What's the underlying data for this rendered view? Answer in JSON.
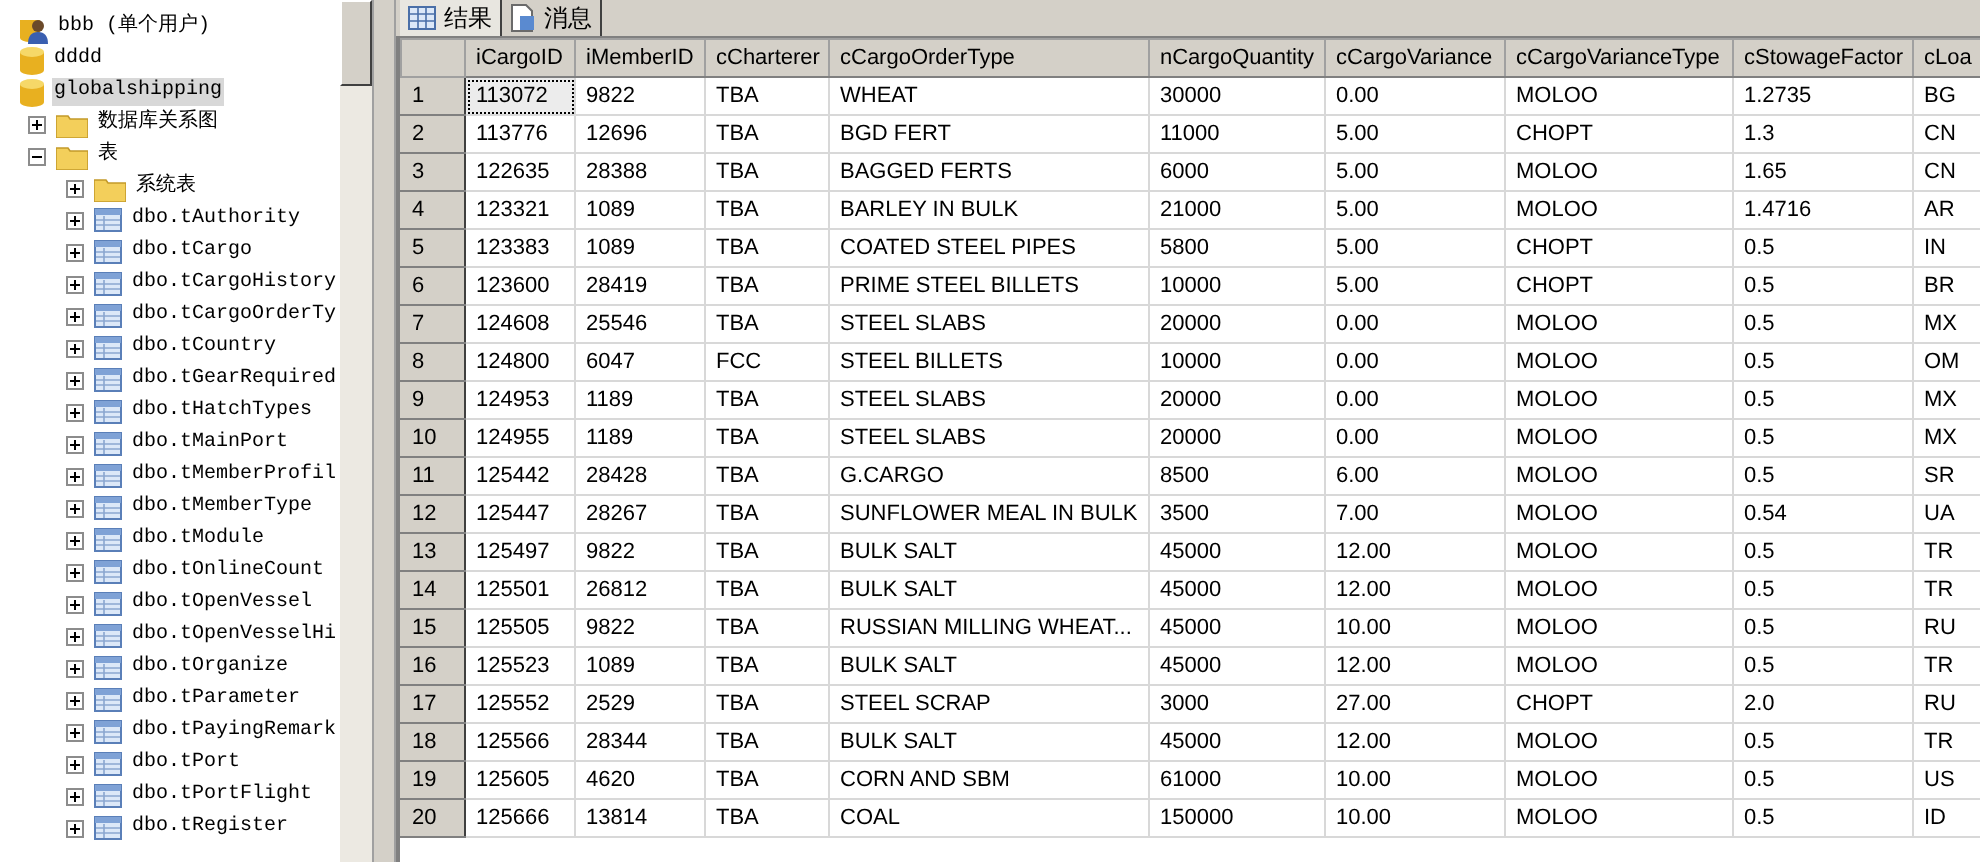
{
  "tree": [
    {
      "label": "bbb (单个用户)",
      "kind": "user"
    },
    {
      "label": "dddd",
      "kind": "database"
    },
    {
      "label": "globalshipping",
      "kind": "database",
      "selected": true,
      "children": [
        {
          "label": "数据库关系图",
          "kind": "folder",
          "expanded": false
        },
        {
          "label": "表",
          "kind": "folder",
          "expanded": true,
          "children": [
            {
              "label": "系统表",
              "kind": "folder",
              "expanded": false
            },
            {
              "label": "dbo.tAuthority",
              "kind": "table",
              "expanded": false
            },
            {
              "label": "dbo.tCargo",
              "kind": "table",
              "expanded": false
            },
            {
              "label": "dbo.tCargoHistory",
              "kind": "table",
              "expanded": false
            },
            {
              "label": "dbo.tCargoOrderTy",
              "kind": "table",
              "expanded": false
            },
            {
              "label": "dbo.tCountry",
              "kind": "table",
              "expanded": false
            },
            {
              "label": "dbo.tGearRequired",
              "kind": "table",
              "expanded": false
            },
            {
              "label": "dbo.tHatchTypes",
              "kind": "table",
              "expanded": false
            },
            {
              "label": "dbo.tMainPort",
              "kind": "table",
              "expanded": false
            },
            {
              "label": "dbo.tMemberProfil",
              "kind": "table",
              "expanded": false
            },
            {
              "label": "dbo.tMemberType",
              "kind": "table",
              "expanded": false
            },
            {
              "label": "dbo.tModule",
              "kind": "table",
              "expanded": false
            },
            {
              "label": "dbo.tOnlineCount",
              "kind": "table",
              "expanded": false
            },
            {
              "label": "dbo.tOpenVessel",
              "kind": "table",
              "expanded": false
            },
            {
              "label": "dbo.tOpenVesselHi",
              "kind": "table",
              "expanded": false
            },
            {
              "label": "dbo.tOrganize",
              "kind": "table",
              "expanded": false
            },
            {
              "label": "dbo.tParameter",
              "kind": "table",
              "expanded": false
            },
            {
              "label": "dbo.tPayingRemark",
              "kind": "table",
              "expanded": false
            },
            {
              "label": "dbo.tPort",
              "kind": "table",
              "expanded": false
            },
            {
              "label": "dbo.tPortFlight",
              "kind": "table",
              "expanded": false
            },
            {
              "label": "dbo.tRegister",
              "kind": "table",
              "expanded": false
            }
          ]
        }
      ]
    }
  ],
  "tabs": [
    {
      "label": "结果",
      "kind": "grid",
      "selected": true
    },
    {
      "label": "消息",
      "kind": "messages",
      "selected": false
    }
  ],
  "grid": {
    "columns": [
      "iCargoID",
      "iMemberID",
      "cCharterer",
      "cCargoOrderType",
      "nCargoQuantity",
      "cCargoVariance",
      "cCargoVarianceType",
      "cStowageFactor",
      "cLoa"
    ],
    "rows": [
      {
        "number": "1",
        "focused": true,
        "cells": [
          "113072",
          "9822",
          "TBA",
          "WHEAT",
          "30000",
          "0.00",
          "MOLOO",
          "1.2735",
          "BG"
        ]
      },
      {
        "number": "2",
        "focused": false,
        "cells": [
          "113776",
          "12696",
          "TBA",
          "BGD FERT",
          "11000",
          "5.00",
          "CHOPT",
          "1.3",
          "CN"
        ]
      },
      {
        "number": "3",
        "focused": false,
        "cells": [
          "122635",
          "28388",
          "TBA",
          "BAGGED FERTS",
          "6000",
          "5.00",
          "MOLOO",
          "1.65",
          "CN"
        ]
      },
      {
        "number": "4",
        "focused": false,
        "cells": [
          "123321",
          "1089",
          "TBA",
          "BARLEY IN BULK",
          "21000",
          "5.00",
          "MOLOO",
          "1.4716",
          "AR"
        ]
      },
      {
        "number": "5",
        "focused": false,
        "cells": [
          "123383",
          "1089",
          "TBA",
          "COATED STEEL PIPES",
          "5800",
          "5.00",
          "CHOPT",
          "0.5",
          "IN"
        ]
      },
      {
        "number": "6",
        "focused": false,
        "cells": [
          "123600",
          "28419",
          "TBA",
          "PRIME STEEL BILLETS",
          "10000",
          "5.00",
          "CHOPT",
          "0.5",
          "BR"
        ]
      },
      {
        "number": "7",
        "focused": false,
        "cells": [
          "124608",
          "25546",
          "TBA",
          "STEEL SLABS",
          "20000",
          "0.00",
          "MOLOO",
          "0.5",
          "MX"
        ]
      },
      {
        "number": "8",
        "focused": false,
        "cells": [
          "124800",
          "6047",
          "FCC",
          "STEEL BILLETS",
          "10000",
          "0.00",
          "MOLOO",
          "0.5",
          "OM"
        ]
      },
      {
        "number": "9",
        "focused": false,
        "cells": [
          "124953",
          "1189",
          "TBA",
          "STEEL SLABS",
          "20000",
          "0.00",
          "MOLOO",
          "0.5",
          "MX"
        ]
      },
      {
        "number": "10",
        "focused": false,
        "cells": [
          "124955",
          "1189",
          "TBA",
          "STEEL SLABS",
          "20000",
          "0.00",
          "MOLOO",
          "0.5",
          "MX"
        ]
      },
      {
        "number": "11",
        "focused": false,
        "cells": [
          "125442",
          "28428",
          "TBA",
          "G.CARGO",
          "8500",
          "6.00",
          "MOLOO",
          "0.5",
          "SR"
        ]
      },
      {
        "number": "12",
        "focused": false,
        "cells": [
          "125447",
          "28267",
          "TBA",
          "SUNFLOWER MEAL IN BULK",
          "3500",
          "7.00",
          "MOLOO",
          "0.54",
          "UA"
        ]
      },
      {
        "number": "13",
        "focused": false,
        "cells": [
          "125497",
          "9822",
          "TBA",
          "BULK SALT",
          "45000",
          "12.00",
          "MOLOO",
          "0.5",
          "TR"
        ]
      },
      {
        "number": "14",
        "focused": false,
        "cells": [
          "125501",
          "26812",
          "TBA",
          "BULK SALT",
          "45000",
          "12.00",
          "MOLOO",
          "0.5",
          "TR"
        ]
      },
      {
        "number": "15",
        "focused": false,
        "cells": [
          "125505",
          "9822",
          "TBA",
          "RUSSIAN MILLING WHEAT...",
          "45000",
          "10.00",
          "MOLOO",
          "0.5",
          "RU"
        ]
      },
      {
        "number": "16",
        "focused": false,
        "cells": [
          "125523",
          "1089",
          "TBA",
          "BULK SALT",
          "45000",
          "12.00",
          "MOLOO",
          "0.5",
          "TR"
        ]
      },
      {
        "number": "17",
        "focused": false,
        "cells": [
          "125552",
          "2529",
          "TBA",
          "STEEL SCRAP",
          "3000",
          "27.00",
          "CHOPT",
          "2.0",
          "RU"
        ]
      },
      {
        "number": "18",
        "focused": false,
        "cells": [
          "125566",
          "28344",
          "TBA",
          "BULK SALT",
          "45000",
          "12.00",
          "MOLOO",
          "0.5",
          "TR"
        ]
      },
      {
        "number": "19",
        "focused": false,
        "cells": [
          "125605",
          "4620",
          "TBA",
          "CORN AND SBM",
          "61000",
          "10.00",
          "MOLOO",
          "0.5",
          "US"
        ]
      },
      {
        "number": "20",
        "focused": false,
        "cells": [
          "125666",
          "13814",
          "TBA",
          "COAL",
          "150000",
          "10.00",
          "MOLOO",
          "0.5",
          "ID"
        ]
      }
    ]
  }
}
